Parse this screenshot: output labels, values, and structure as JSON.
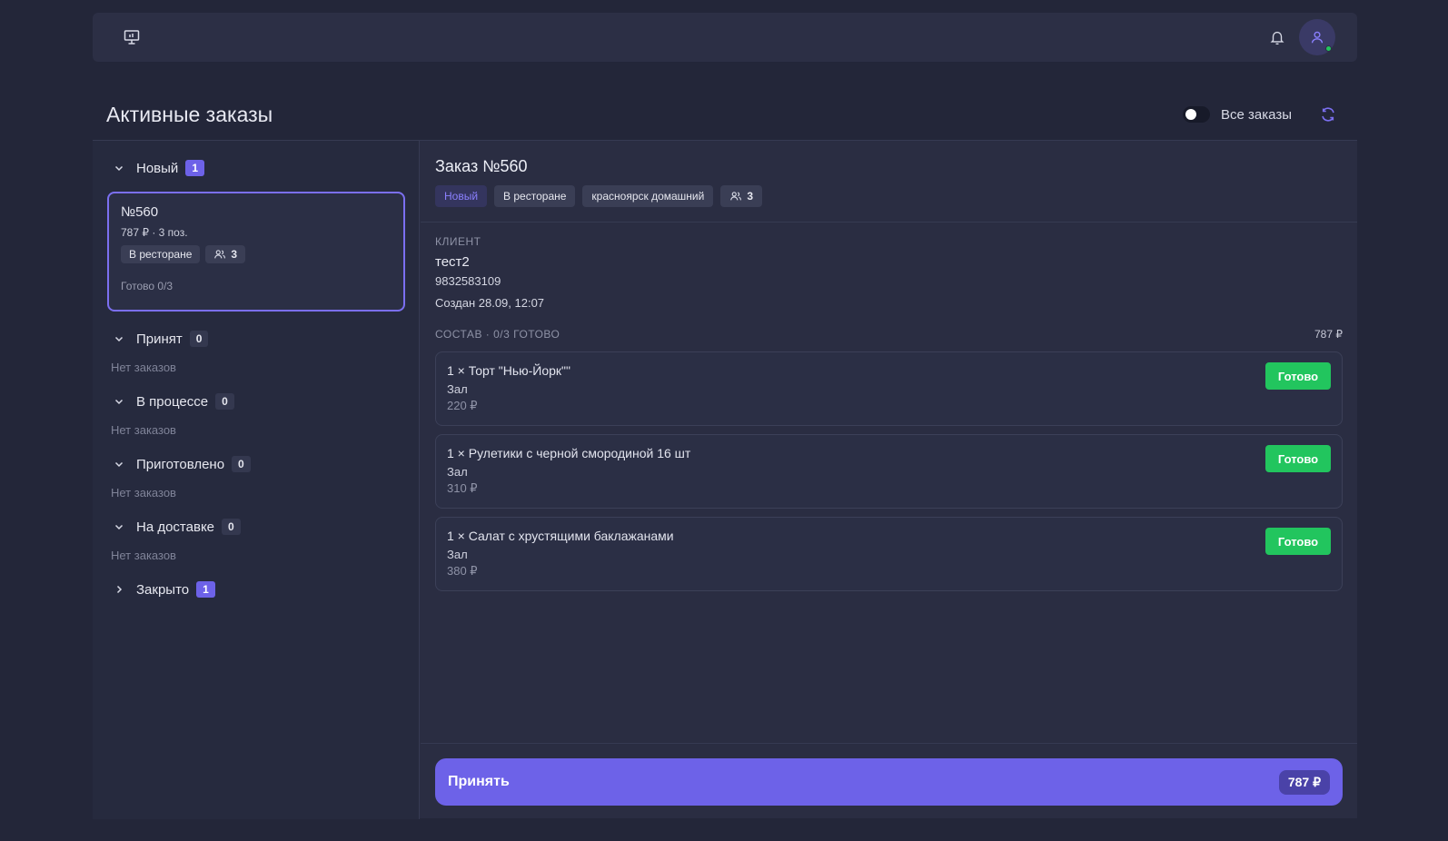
{
  "topbar": {
    "left_icon": "monitor-icon",
    "bell_icon": "bell-icon",
    "avatar_icon": "user-icon"
  },
  "page": {
    "title": "Активные заказы",
    "toggle_label": "Все заказы"
  },
  "groups": [
    {
      "label": "Новый",
      "count": "1",
      "expanded": true,
      "empty_text": ""
    },
    {
      "label": "Принят",
      "count": "0",
      "expanded": true,
      "empty_text": "Нет заказов"
    },
    {
      "label": "В процессе",
      "count": "0",
      "expanded": true,
      "empty_text": "Нет заказов"
    },
    {
      "label": "Приготовлено",
      "count": "0",
      "expanded": true,
      "empty_text": "Нет заказов"
    },
    {
      "label": "На доставке",
      "count": "0",
      "expanded": true,
      "empty_text": "Нет заказов"
    },
    {
      "label": "Закрыто",
      "count": "1",
      "expanded": false,
      "empty_text": ""
    }
  ],
  "order_card": {
    "number": "№560",
    "meta": "787 ₽ · 3 поз.",
    "tag_place": "В ресторане",
    "guests": "3",
    "ready": "Готово 0/3"
  },
  "detail": {
    "title": "Заказ №560",
    "status_tag": "Новый",
    "place_tag": "В ресторане",
    "branch_tag": "красноярск домашний",
    "guests": "3",
    "client_label": "КЛИЕНТ",
    "client_name": "тест2",
    "client_phone": "9832583109",
    "created": "Создан 28.09, 12:07",
    "composition_label": "СОСТАВ · 0/3 ГОТОВО",
    "composition_total": "787 ₽",
    "items": [
      {
        "name": "1 × Торт \"Нью-Йорк\"\"",
        "place": "Зал",
        "price": "220 ₽",
        "button": "Готово"
      },
      {
        "name": "1 × Рулетики с черной смородиной 16 шт",
        "place": "Зал",
        "price": "310 ₽",
        "button": "Готово"
      },
      {
        "name": "1 × Салат с хрустящими баклажанами",
        "place": "Зал",
        "price": "380 ₽",
        "button": "Готово"
      }
    ],
    "accept_label": "Принять",
    "accept_amount": "787 ₽"
  },
  "colors": {
    "accent": "#6d62e8",
    "success": "#22c55e",
    "background": "#232639"
  }
}
